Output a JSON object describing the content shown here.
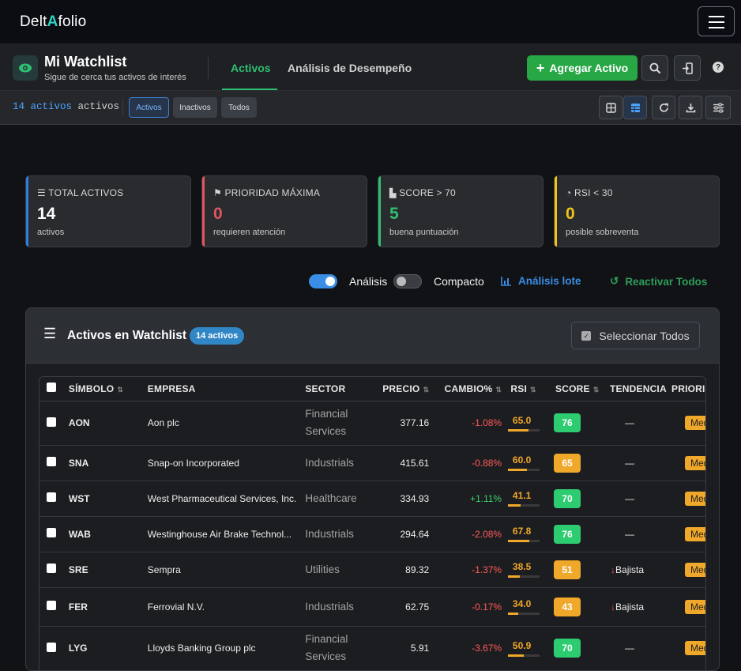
{
  "brand": {
    "pre": "Delt",
    "mark": "A",
    "post": "folio"
  },
  "header": {
    "title": "Mi Watchlist",
    "subtitle": "Sigue de cerca tus activos de interés",
    "tabs": [
      "Activos",
      "Análisis de Desempeño"
    ],
    "add_button": "Agregar Activo"
  },
  "filters": {
    "count_num": "14 activos",
    "count_suffix": " activos",
    "buttons": [
      "Activos",
      "Inactivos",
      "Todos"
    ]
  },
  "cards": [
    {
      "label": "TOTAL ACTIVOS",
      "value": "14",
      "desc": "activos",
      "color": "#2f7be0",
      "icon": "list-icon"
    },
    {
      "label": "PRIORIDAD MÁXIMA",
      "value": "0",
      "desc": "requieren atención",
      "color": "#e05561",
      "icon": "flag-icon"
    },
    {
      "label": "SCORE > 70",
      "value": "5",
      "desc": "buena puntuación",
      "color": "#2fbf71",
      "icon": "chart-icon"
    },
    {
      "label": "RSI < 30",
      "value": "0",
      "desc": "posible sobreventa",
      "color": "#f0c419",
      "icon": "gauge-icon"
    }
  ],
  "controls": {
    "toggle1_label": "Análisis",
    "toggle1_on": true,
    "toggle2_label": "Compacto",
    "toggle2_on": false,
    "batch_label": "Análisis lote",
    "reactivate_label": "Reactivar Todos"
  },
  "panel": {
    "title": "Activos en Watchlist",
    "badge": "14 activos",
    "select_all": "Seleccionar Todos"
  },
  "table": {
    "headers": [
      "SÍMBOLO",
      "EMPRESA",
      "SECTOR",
      "PRECIO",
      "CAMBIO%",
      "RSI",
      "SCORE",
      "TENDENCIA",
      "PRIORIDAD"
    ],
    "rows": [
      {
        "symbol": "AON",
        "company": "Aon plc",
        "sector": "Financial Services",
        "price": "377.16",
        "change": "-1.08%",
        "rsi": "65.0",
        "score": "76",
        "trend": "—",
        "priority": "Media"
      },
      {
        "symbol": "SNA",
        "company": "Snap-on Incorporated",
        "sector": "Industrials",
        "price": "415.61",
        "change": "-0.88%",
        "rsi": "60.0",
        "score": "65",
        "trend": "—",
        "priority": "Media"
      },
      {
        "symbol": "WST",
        "company": "West Pharmaceutical Services, Inc.",
        "sector": "Healthcare",
        "price": "334.93",
        "change": "+1.11%",
        "rsi": "41.1",
        "score": "70",
        "trend": "—",
        "priority": "Media"
      },
      {
        "symbol": "WAB",
        "company": "Westinghouse Air Brake Technol...",
        "sector": "Industrials",
        "price": "294.64",
        "change": "-2.08%",
        "rsi": "67.8",
        "score": "76",
        "trend": "—",
        "priority": "Media"
      },
      {
        "symbol": "SRE",
        "company": "Sempra",
        "sector": "Utilities",
        "price": "89.32",
        "change": "-1.37%",
        "rsi": "38.5",
        "score": "51",
        "trend": "Bajista",
        "priority": "Media"
      },
      {
        "symbol": "FER",
        "company": "Ferrovial N.V.",
        "sector": "Industrials",
        "price": "62.75",
        "change": "-0.17%",
        "rsi": "34.0",
        "score": "43",
        "trend": "Bajista",
        "priority": "Media"
      },
      {
        "symbol": "LYG",
        "company": "Lloyds Banking Group plc",
        "sector": "Financial Services",
        "price": "5.91",
        "change": "-3.67%",
        "rsi": "50.9",
        "score": "70",
        "trend": "—",
        "priority": "Media"
      }
    ]
  },
  "colors": {
    "green": "#2ecc71",
    "orange": "#f0a82a",
    "accent": "#2fbf71"
  }
}
